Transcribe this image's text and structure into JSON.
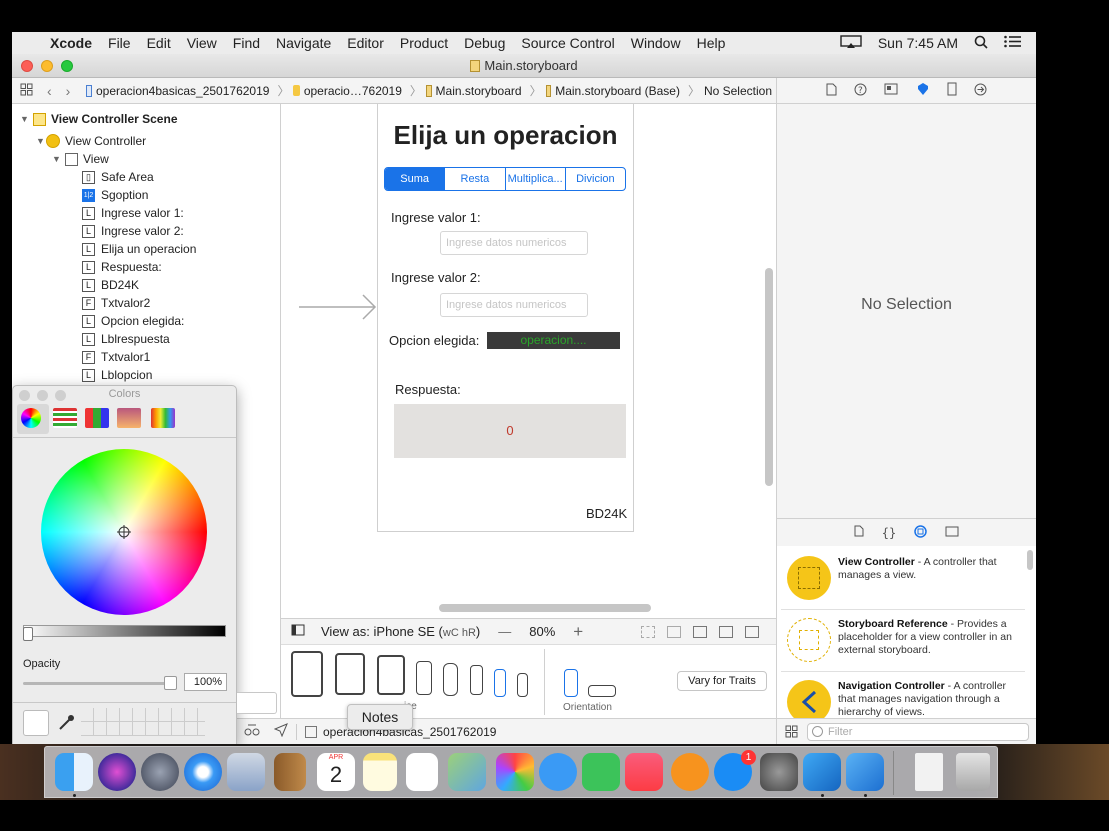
{
  "menubar": {
    "apple": "",
    "app": "Xcode",
    "items": [
      "File",
      "Edit",
      "View",
      "Find",
      "Navigate",
      "Editor",
      "Product",
      "Debug",
      "Source Control",
      "Window",
      "Help"
    ],
    "clock": "Sun 7:45 AM"
  },
  "window": {
    "title": "Main.storyboard"
  },
  "jumpbar": {
    "crumbs": [
      "operacion4basicas_2501762019",
      "operacio…762019",
      "Main.storyboard",
      "Main.storyboard (Base)",
      "No Selection"
    ]
  },
  "outline": {
    "scene": "View Controller Scene",
    "controller": "View Controller",
    "view": "View",
    "items": [
      {
        "badge": "▯",
        "label": "Safe Area"
      },
      {
        "badge": "1|2",
        "label": "Sgoption"
      },
      {
        "badge": "L",
        "label": "Ingrese valor 1:"
      },
      {
        "badge": "L",
        "label": "Ingrese valor 2:"
      },
      {
        "badge": "L",
        "label": "Elija un operacion"
      },
      {
        "badge": "L",
        "label": "Respuesta:"
      },
      {
        "badge": "L",
        "label": "BD24K"
      },
      {
        "badge": "F",
        "label": "Txtvalor2"
      },
      {
        "badge": "L",
        "label": "Opcion elegida:"
      },
      {
        "badge": "L",
        "label": "Lblrespuesta"
      },
      {
        "badge": "F",
        "label": "Txtvalor1"
      },
      {
        "badge": "L",
        "label": "Lblopcion"
      }
    ]
  },
  "storyboard": {
    "title": "Elija un operacion",
    "segments": [
      "Suma",
      "Resta",
      "Multiplica...",
      "Divicion"
    ],
    "label1": "Ingrese valor 1:",
    "placeholder1": "Ingrese datos numericos",
    "label2": "Ingrese valor 2:",
    "placeholder2": "Ingrese datos numericos",
    "opcion_label": "Opcion elegida:",
    "opcion_value": "operacion....",
    "respuesta_label": "Respuesta:",
    "respuesta_value": "0",
    "footer": "BD24K"
  },
  "viewas": {
    "label": "View as: iPhone SE (",
    "traits": "wC hR",
    "close": ")",
    "minus": "—",
    "zoom": "80%",
    "plus": "+"
  },
  "devices": {
    "device_label": "ice",
    "orientation_label": "Orientation",
    "vary_button": "Vary for Traits"
  },
  "statusbar": {
    "project": "operacion4basicas_2501762019"
  },
  "tooltip": "Notes",
  "inspector": {
    "empty": "No Selection"
  },
  "library": {
    "items": [
      {
        "name": "View Controller",
        "desc": " - A controller that manages a view."
      },
      {
        "name": "Storyboard Reference",
        "desc": " - Provides a placeholder for a view controller in an external storyboard."
      },
      {
        "name": "Navigation Controller",
        "desc": " - A controller that manages navigation through a hierarchy of views."
      }
    ],
    "filter_placeholder": "Filter"
  },
  "colors_panel": {
    "title": "Colors",
    "opacity_label": "Opacity",
    "opacity_value": "100%"
  },
  "dock": {
    "calendar_month": "APR",
    "calendar_day": "2",
    "appstore_badge": "1"
  },
  "accent_colors": {
    "xcode_blue": "#1a73e8",
    "vc_yellow": "#f5c518",
    "opcion_bg": "#3a3a3a",
    "opcion_text": "#2aa52a",
    "respuesta_text": "#c0392b"
  }
}
